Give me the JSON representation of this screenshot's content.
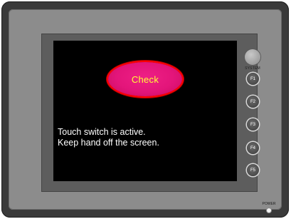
{
  "screen": {
    "check_button_label": "Check",
    "message_line1": "Touch switch is active.",
    "message_line2": "Keep hand off the screen."
  },
  "side_keys": {
    "system_label": "SYSTEM",
    "keys": [
      "F1",
      "F2",
      "F3",
      "F4",
      "F5"
    ]
  },
  "power": {
    "label": "POWER"
  },
  "colors": {
    "screen_background": "#000000",
    "button_fill": "#e3157a",
    "button_outline": "#ff0000",
    "button_text": "#ffff33",
    "message_text": "#ffffff",
    "panel_gray": "#8c8c8c",
    "housing": "#3a3a3a"
  },
  "icons": {
    "system_button": "round-gray-button-icon",
    "function_key": "round-dark-key-icon",
    "power_indicator": "led-indicator-icon"
  }
}
